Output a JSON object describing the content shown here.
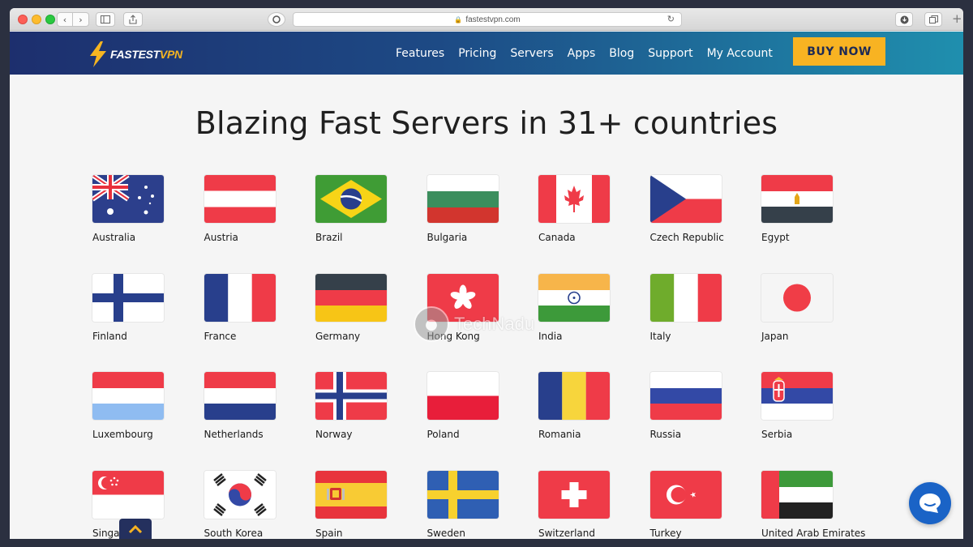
{
  "browser": {
    "url": "fastestvpn.com"
  },
  "header": {
    "logo_main": "FASTEST",
    "logo_accent": "VPN",
    "nav": [
      "Features",
      "Pricing",
      "Servers",
      "Apps",
      "Blog",
      "Support",
      "My Account"
    ],
    "cta": "BUY NOW"
  },
  "main": {
    "title": "Blazing Fast Servers in 31+ countries"
  },
  "countries": [
    {
      "name": "Australia",
      "flag": "au"
    },
    {
      "name": "Austria",
      "flag": "at"
    },
    {
      "name": "Brazil",
      "flag": "br"
    },
    {
      "name": "Bulgaria",
      "flag": "bg"
    },
    {
      "name": "Canada",
      "flag": "ca"
    },
    {
      "name": "Czech Republic",
      "flag": "cz"
    },
    {
      "name": "Egypt",
      "flag": "eg"
    },
    {
      "name": "Finland",
      "flag": "fi"
    },
    {
      "name": "France",
      "flag": "fr"
    },
    {
      "name": "Germany",
      "flag": "de"
    },
    {
      "name": "Hong Kong",
      "flag": "hk"
    },
    {
      "name": "India",
      "flag": "in"
    },
    {
      "name": "Italy",
      "flag": "it"
    },
    {
      "name": "Japan",
      "flag": "jp"
    },
    {
      "name": "Luxembourg",
      "flag": "lu"
    },
    {
      "name": "Netherlands",
      "flag": "nl"
    },
    {
      "name": "Norway",
      "flag": "no"
    },
    {
      "name": "Poland",
      "flag": "pl"
    },
    {
      "name": "Romania",
      "flag": "ro"
    },
    {
      "name": "Russia",
      "flag": "ru"
    },
    {
      "name": "Serbia",
      "flag": "rs"
    },
    {
      "name": "Singapore",
      "flag": "sg"
    },
    {
      "name": "South Korea",
      "flag": "kr"
    },
    {
      "name": "Spain",
      "flag": "es"
    },
    {
      "name": "Sweden",
      "flag": "se"
    },
    {
      "name": "Switzerland",
      "flag": "ch"
    },
    {
      "name": "Turkey",
      "flag": "tr"
    },
    {
      "name": "United Arab Emirates",
      "flag": "ae"
    }
  ],
  "watermark": "TechNadu",
  "colors": {
    "accent": "#f8b322",
    "header_start": "#1d2f6e",
    "header_end": "#1f8fae",
    "chat": "#1a63c6"
  },
  "icons": {
    "scroll_top": "chevron-up-icon",
    "chat": "chat-bubble-icon",
    "logo": "lightning-bolt-icon"
  }
}
